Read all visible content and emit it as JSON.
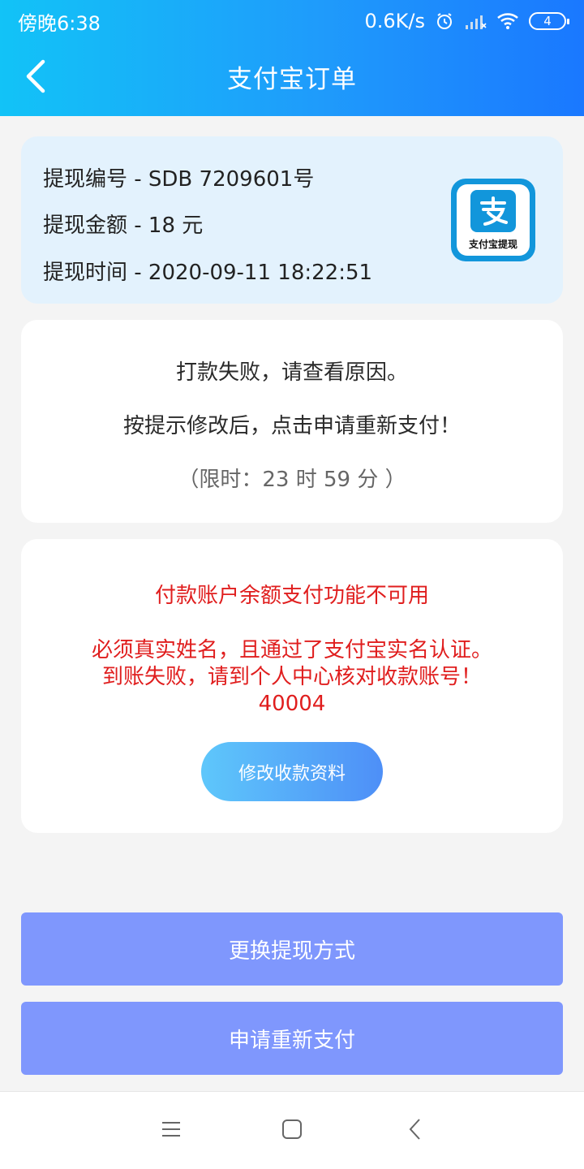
{
  "status_bar": {
    "time": "傍晚6:38",
    "network_speed": "0.6K/s",
    "battery_level": "4"
  },
  "header": {
    "title": "支付宝订单"
  },
  "withdrawal_info": {
    "number_line": "提现编号 - SDB 7209601号",
    "amount_line": "提现金额 - 18 元",
    "time_line": "提现时间 - 2020-09-11 18:22:51",
    "logo_caption": "支付宝提现"
  },
  "notice": {
    "line1": "打款失败，请查看原因。",
    "line2": "按提示修改后，点击申请重新支付！",
    "time_limit": "（限时：23 时 59 分 ）"
  },
  "error": {
    "title": "付款账户余额支付功能不可用",
    "line1": "必须真实姓名，且通过了支付宝实名认证。",
    "line2": "到账失败，请到个人中心核对收款账号！",
    "code": "40004",
    "modify_button_label": "修改收款资料"
  },
  "actions": {
    "change_method_label": "更换提现方式",
    "retry_payment_label": "申请重新支付"
  },
  "colors": {
    "header_start": "#12c3f7",
    "header_end": "#1a78ff",
    "error_text": "#e01e1e",
    "action_button": "#7f97fd",
    "alipay_blue": "#1296db"
  },
  "icons": {
    "back": "chevron-left-icon",
    "alarm": "alarm-icon",
    "signal": "signal-icon",
    "wifi": "wifi-icon",
    "menu": "menu-icon",
    "home": "home-icon",
    "nav_back": "back-icon"
  }
}
